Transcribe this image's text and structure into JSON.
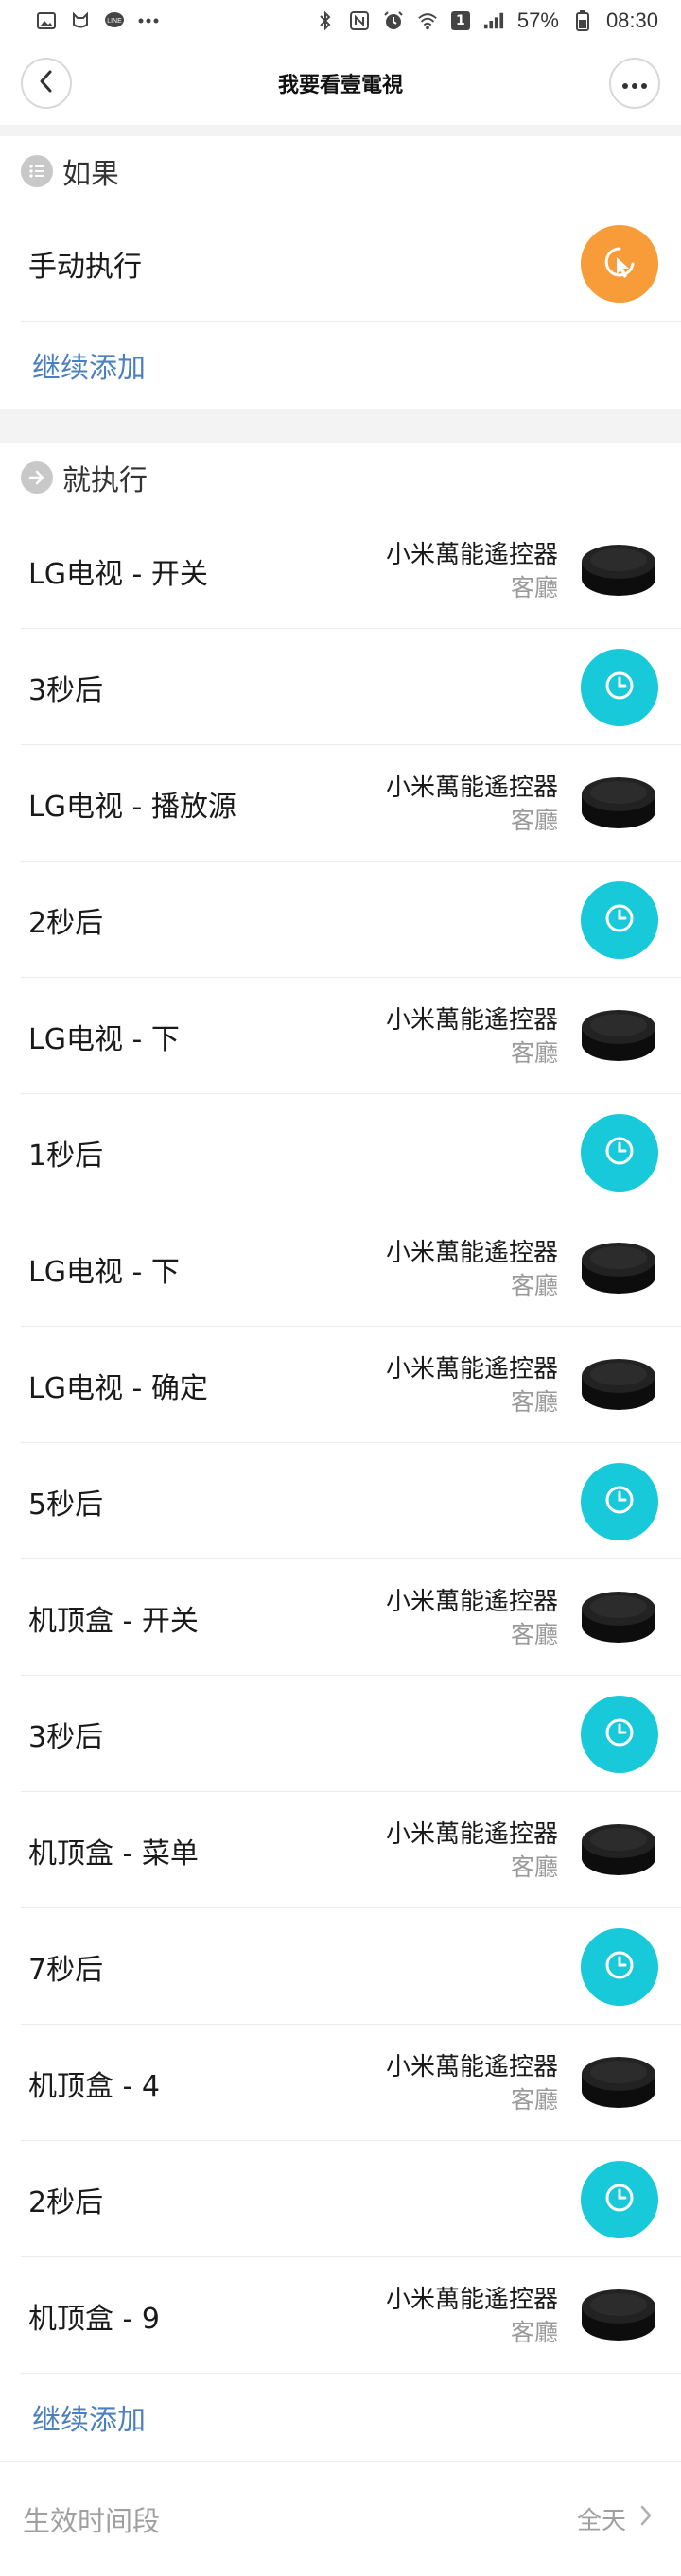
{
  "status_bar": {
    "battery_percent": "57%",
    "time": "08:30",
    "sim_slot": "1"
  },
  "header": {
    "title": "我要看壹電視"
  },
  "if_section": {
    "title": "如果",
    "trigger_label": "手动执行",
    "add_more": "继续添加"
  },
  "then_section": {
    "title": "就执行",
    "actions": [
      {
        "label": "LG电视 - 开关",
        "device": "小米萬能遙控器",
        "room": "客廳",
        "kind": "device"
      },
      {
        "label": "3秒后",
        "kind": "delay"
      },
      {
        "label": "LG电视 - 播放源",
        "device": "小米萬能遙控器",
        "room": "客廳",
        "kind": "device"
      },
      {
        "label": "2秒后",
        "kind": "delay"
      },
      {
        "label": "LG电视 - 下",
        "device": "小米萬能遙控器",
        "room": "客廳",
        "kind": "device"
      },
      {
        "label": "1秒后",
        "kind": "delay"
      },
      {
        "label": "LG电视 - 下",
        "device": "小米萬能遙控器",
        "room": "客廳",
        "kind": "device"
      },
      {
        "label": "LG电视 - 确定",
        "device": "小米萬能遙控器",
        "room": "客廳",
        "kind": "device"
      },
      {
        "label": "5秒后",
        "kind": "delay"
      },
      {
        "label": "机顶盒 - 开关",
        "device": "小米萬能遙控器",
        "room": "客廳",
        "kind": "device"
      },
      {
        "label": "3秒后",
        "kind": "delay"
      },
      {
        "label": "机顶盒 - 菜单",
        "device": "小米萬能遙控器",
        "room": "客廳",
        "kind": "device"
      },
      {
        "label": "7秒后",
        "kind": "delay"
      },
      {
        "label": "机顶盒 - 4",
        "device": "小米萬能遙控器",
        "room": "客廳",
        "kind": "device"
      },
      {
        "label": "2秒后",
        "kind": "delay"
      },
      {
        "label": "机顶盒 - 9",
        "device": "小米萬能遙控器",
        "room": "客廳",
        "kind": "device"
      }
    ],
    "add_more": "继续添加"
  },
  "effective_period": {
    "label": "生效时间段",
    "value": "全天"
  },
  "colors": {
    "accent_orange": "#f89c3a",
    "accent_cyan": "#18c9d9",
    "link_blue": "#4a7fc1"
  },
  "icons": {
    "back": "chevron-left-icon",
    "more": "more-dots-icon",
    "trigger": "hand-cursor-icon",
    "delay": "clock-icon",
    "device": "ir-remote-puck-icon"
  }
}
